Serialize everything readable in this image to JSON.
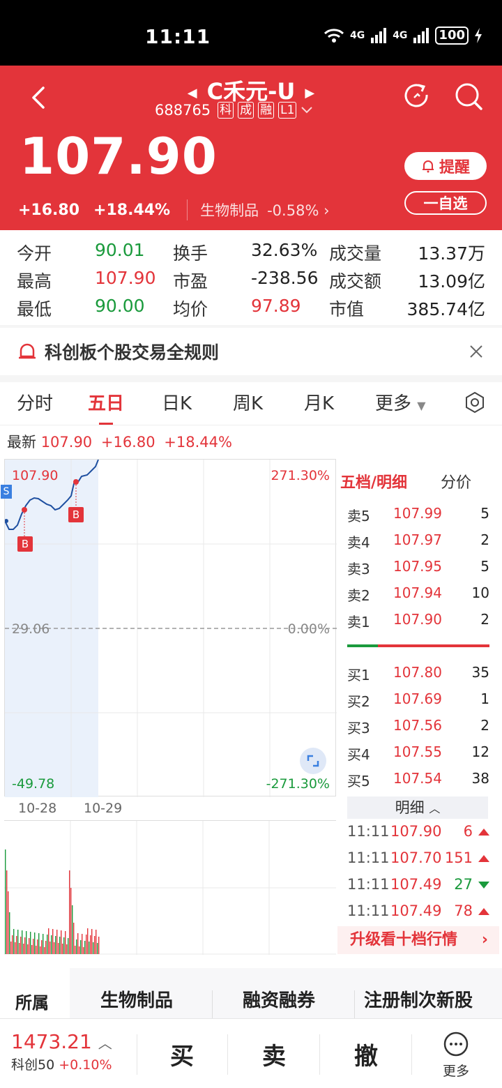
{
  "status": {
    "time": "11:11",
    "net1": "4G",
    "net2": "4G",
    "battery": "100"
  },
  "header": {
    "title": "C禾元-U",
    "code": "688765",
    "tags": [
      "科",
      "成",
      "融",
      "L1"
    ],
    "price": "107.90",
    "change": "+16.80",
    "change_pct": "+18.44%",
    "sector": "生物制品",
    "sector_pct": "-0.58%",
    "remind_label": "提醒",
    "watch_label": "一自选"
  },
  "stats": {
    "open_label": "今开",
    "open": "90.01",
    "high_label": "最高",
    "high": "107.90",
    "low_label": "最低",
    "low": "90.00",
    "turnover_label": "换手",
    "turnover": "32.63%",
    "pe_label": "市盈",
    "pe": "-238.56",
    "avg_label": "均价",
    "avg": "97.89",
    "vol_label": "成交量",
    "vol": "13.37万",
    "amt_label": "成交额",
    "amt": "13.09亿",
    "cap_label": "市值",
    "cap": "385.74亿"
  },
  "notice": {
    "text": "科创板个股交易全规则"
  },
  "tabs": [
    {
      "label": "分时"
    },
    {
      "label": "五日"
    },
    {
      "label": "日K"
    },
    {
      "label": "周K"
    },
    {
      "label": "月K"
    },
    {
      "label": "更多"
    }
  ],
  "latest": {
    "label": "最新",
    "price": "107.90",
    "change": "+16.80",
    "pct": "+18.44%"
  },
  "chart": {
    "top_price": "107.90",
    "top_pct": "271.30%",
    "mid_price": "29.06",
    "mid_pct": "0.00%",
    "bot_price": "-49.78",
    "bot_pct": "-271.30%",
    "dates": [
      "10-28",
      "10-29"
    ],
    "markers": [
      "S",
      "B",
      "B"
    ]
  },
  "orderbook": {
    "tab1": "五档/明细",
    "tab2": "分价",
    "asks": [
      {
        "name": "卖5",
        "price": "107.99",
        "vol": "5"
      },
      {
        "name": "卖4",
        "price": "107.97",
        "vol": "2"
      },
      {
        "name": "卖3",
        "price": "107.95",
        "vol": "5"
      },
      {
        "name": "卖2",
        "price": "107.94",
        "vol": "10"
      },
      {
        "name": "卖1",
        "price": "107.90",
        "vol": "2"
      }
    ],
    "bids": [
      {
        "name": "买1",
        "price": "107.80",
        "vol": "35"
      },
      {
        "name": "买2",
        "price": "107.69",
        "vol": "1"
      },
      {
        "name": "买3",
        "price": "107.56",
        "vol": "2"
      },
      {
        "name": "买4",
        "price": "107.55",
        "vol": "12"
      },
      {
        "name": "买5",
        "price": "107.54",
        "vol": "38"
      }
    ],
    "detail_label": "明细",
    "trades": [
      {
        "time": "11:11",
        "price": "107.90",
        "vol": "6",
        "dir": "up"
      },
      {
        "time": "11:11",
        "price": "107.70",
        "vol": "151",
        "dir": "up"
      },
      {
        "time": "11:11",
        "price": "107.49",
        "vol": "27",
        "dir": "down"
      },
      {
        "time": "11:11",
        "price": "107.49",
        "vol": "78",
        "dir": "up"
      }
    ],
    "upgrade": "升级看十档行情"
  },
  "industry": {
    "first": "所属",
    "items": [
      "生物制品",
      "融资融券",
      "注册制次新股"
    ]
  },
  "bottom": {
    "index_value": "1473.21",
    "index_name": "科创50",
    "index_pct": "+0.10%",
    "buy": "买",
    "sell": "卖",
    "cancel": "撤",
    "more": "更多"
  }
}
